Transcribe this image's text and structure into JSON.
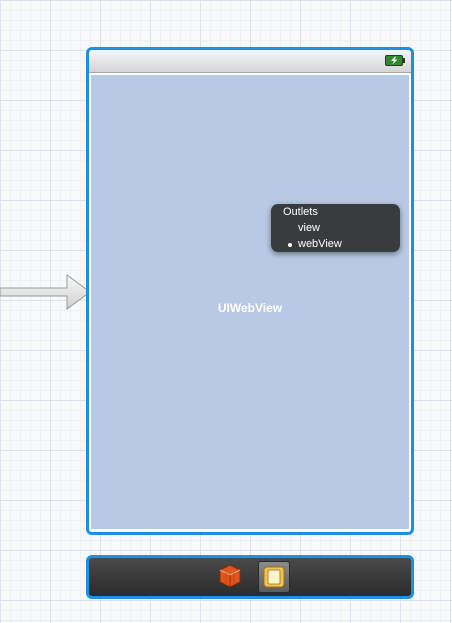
{
  "scene": {
    "content_label": "UIWebView",
    "outlets_popup": {
      "title": "Outlets",
      "items": [
        "view",
        "webView"
      ],
      "connected_item": "webView"
    },
    "status_bar": {
      "battery_icon": "battery-charging-icon"
    },
    "dock": {
      "icons": [
        "first-responder-cube-icon",
        "view-controller-icon"
      ]
    }
  },
  "colors": {
    "selection_border": "#1c8fe6",
    "web_view_fill": "#b7c9e4",
    "popup_background": "#282828"
  }
}
